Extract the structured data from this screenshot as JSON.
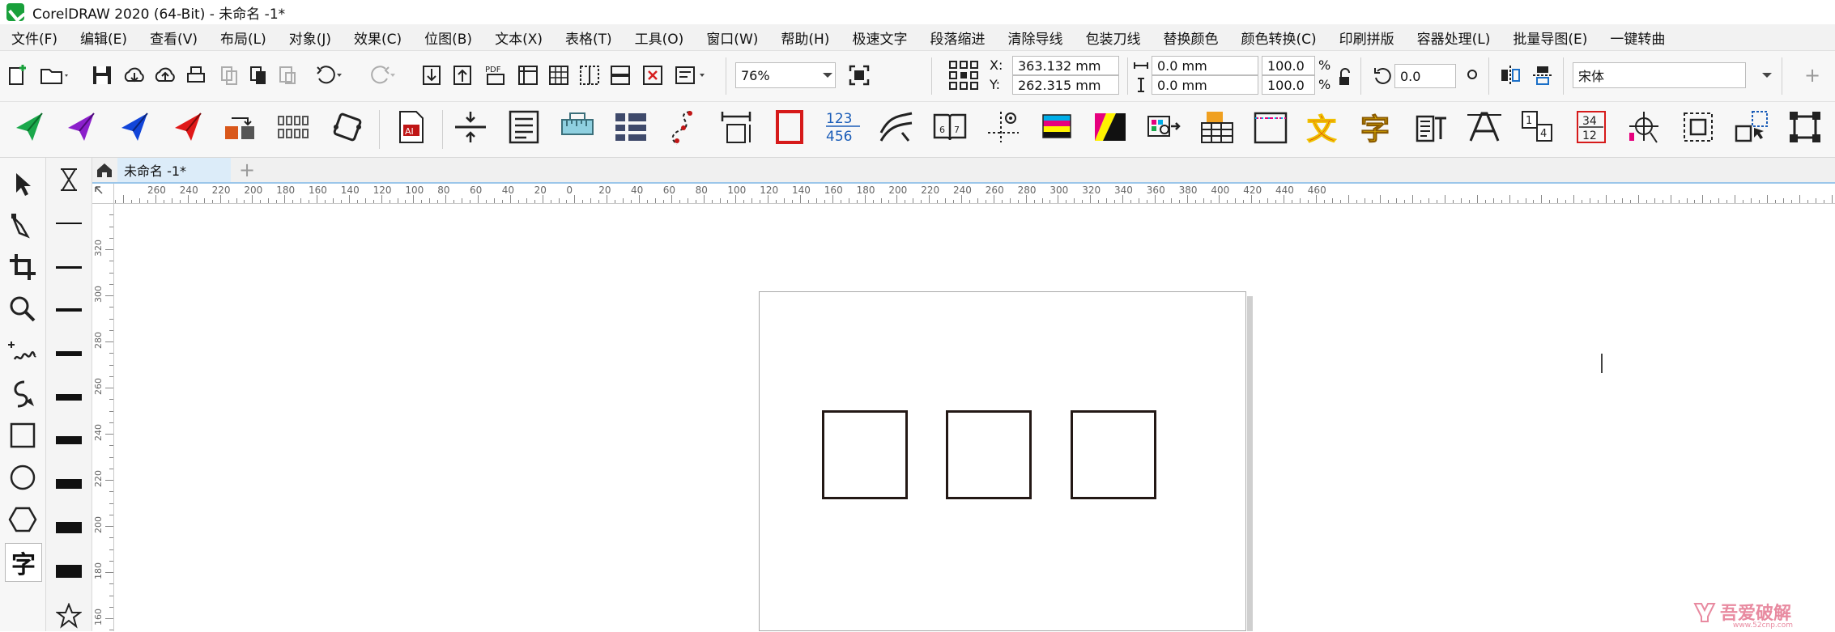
{
  "window": {
    "title": "CorelDRAW 2020 (64-Bit) - 未命名 -1*"
  },
  "menu": [
    "文件(F)",
    "编辑(E)",
    "查看(V)",
    "布局(L)",
    "对象(J)",
    "效果(C)",
    "位图(B)",
    "文本(X)",
    "表格(T)",
    "工具(O)",
    "窗口(W)",
    "帮助(H)",
    "极速文字",
    "段落缩进",
    "清除导线",
    "包装刀线",
    "替换颜色",
    "颜色转换(C)",
    "印刷拼版",
    "容器处理(L)",
    "批量导图(E)",
    "一键转曲"
  ],
  "toolbar": {
    "pdf_label": "PDF",
    "zoom": "76%",
    "x_label": "X:",
    "y_label": "Y:",
    "x_value": "363.132 mm",
    "y_value": "262.315 mm",
    "w_value": "0.0 mm",
    "h_value": "0.0 mm",
    "scale_w": "100.0",
    "scale_h": "100.0",
    "percent": "%",
    "angle": "0.0",
    "font": "宋体",
    "plus": "+"
  },
  "tabs": {
    "doc_tab": "未命名 -1*",
    "add": "+"
  },
  "ruler": {
    "unit": "mm",
    "h_labels": [
      "260",
      "240",
      "220",
      "200",
      "180",
      "160",
      "140",
      "120",
      "100",
      "80",
      "60",
      "40",
      "20",
      "0",
      "20",
      "40",
      "60",
      "80",
      "100",
      "120",
      "140",
      "160",
      "180",
      "200",
      "220",
      "240",
      "260",
      "280",
      "300",
      "320",
      "340",
      "360",
      "380",
      "400",
      "420",
      "440",
      "460"
    ],
    "v_labels": [
      "320",
      "300",
      "280",
      "260",
      "240",
      "220",
      "200",
      "180",
      "160"
    ]
  },
  "lefttools": [
    "pick-tool",
    "shape-tool",
    "crop-tool",
    "zoom-tool",
    "freehand-tool",
    "artistic-media-tool",
    "rectangle-tool",
    "ellipse-tool",
    "polygon-tool",
    "text-tool"
  ],
  "text_tool_glyph": "字",
  "canvas": {
    "squares": 3
  },
  "watermark": {
    "logo": "吾爱破解",
    "url": "www.52cnp.com"
  },
  "colors": {
    "accent": "#9bc6ea",
    "shape_stroke": "#231815",
    "logo_green": "#19a03b"
  }
}
